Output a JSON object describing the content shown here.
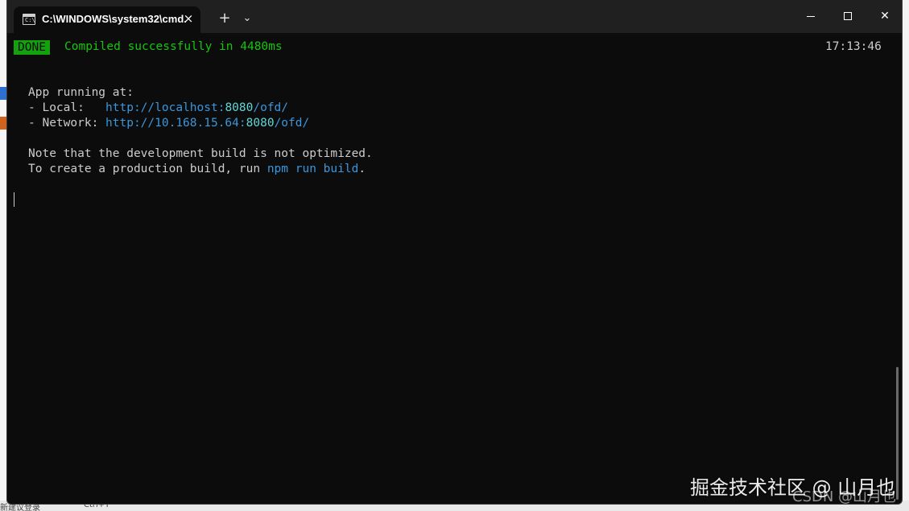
{
  "titlebar": {
    "tab_title": "C:\\WINDOWS\\system32\\cmd.",
    "tab_icon_glyph": "C:\\",
    "tab_close": "×",
    "new_tab": "+",
    "dropdown": "⌄",
    "maximize": "",
    "close": "✕"
  },
  "terminal": {
    "badge": "DONE",
    "compiled_message": "Compiled successfully in 4480ms",
    "timestamp": "17:13:46",
    "app_running": "App running at:",
    "local_label": "- Local:   ",
    "local_url_prefix": "http://localhost:",
    "local_port": "8080",
    "local_url_suffix": "/ofd/",
    "network_label": "- Network: ",
    "network_url_prefix": "http://10.168.15.64:",
    "network_port": "8080",
    "network_url_suffix": "/ofd/",
    "note_line1": "Note that the development build is not optimized.",
    "note_line2_prefix": "To create a production build, run ",
    "note_line2_cmd": "npm run build",
    "note_line2_suffix": "."
  },
  "watermark": {
    "primary": "掘金技术社区 @ 山月也",
    "secondary": "CSDN @山月也"
  },
  "background_window": {
    "bottom_left_text": "新建议登录",
    "bottom_shortcut": "Ctrl+T"
  },
  "colors": {
    "terminal_bg": "#0c0c0c",
    "titlebar_bg": "#202020",
    "done_badge": "#13a10e",
    "success_text": "#16c60c",
    "url": "#3a96dd",
    "port": "#61d6d6",
    "text": "#cccccc"
  }
}
